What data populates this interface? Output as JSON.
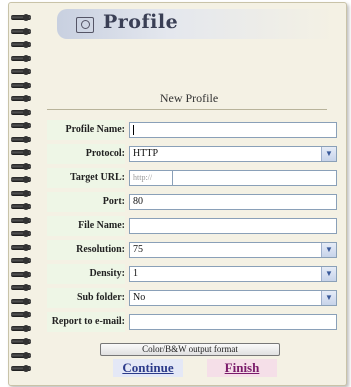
{
  "header": {
    "title": "Profile",
    "icon": "profile-icon"
  },
  "subtitle": "New Profile",
  "fields": [
    {
      "key": "profile_name",
      "label": "Profile Name:",
      "type": "text",
      "value": ""
    },
    {
      "key": "protocol",
      "label": "Protocol:",
      "type": "select",
      "value": "HTTP"
    },
    {
      "key": "target_url",
      "label": "Target URL:",
      "type": "url",
      "prefix": "http://",
      "value": ""
    },
    {
      "key": "port",
      "label": "Port:",
      "type": "text",
      "value": "80"
    },
    {
      "key": "file_name",
      "label": "File Name:",
      "type": "text",
      "value": ""
    },
    {
      "key": "resolution",
      "label": "Resolution:",
      "type": "select",
      "value": "75"
    },
    {
      "key": "density",
      "label": "Density:",
      "type": "select",
      "value": "1"
    },
    {
      "key": "sub_folder",
      "label": "Sub folder:",
      "type": "select",
      "value": "No"
    },
    {
      "key": "report_email",
      "label": "Report to e-mail:",
      "type": "text",
      "value": ""
    }
  ],
  "buttons": {
    "output_format": "Color/B&W output format",
    "continue": "Continue",
    "finish": "Finish"
  },
  "colors": {
    "label_bg": "#eef6e6",
    "continue_bg": "#e4e8f6",
    "finish_bg": "#f5dfe8"
  }
}
